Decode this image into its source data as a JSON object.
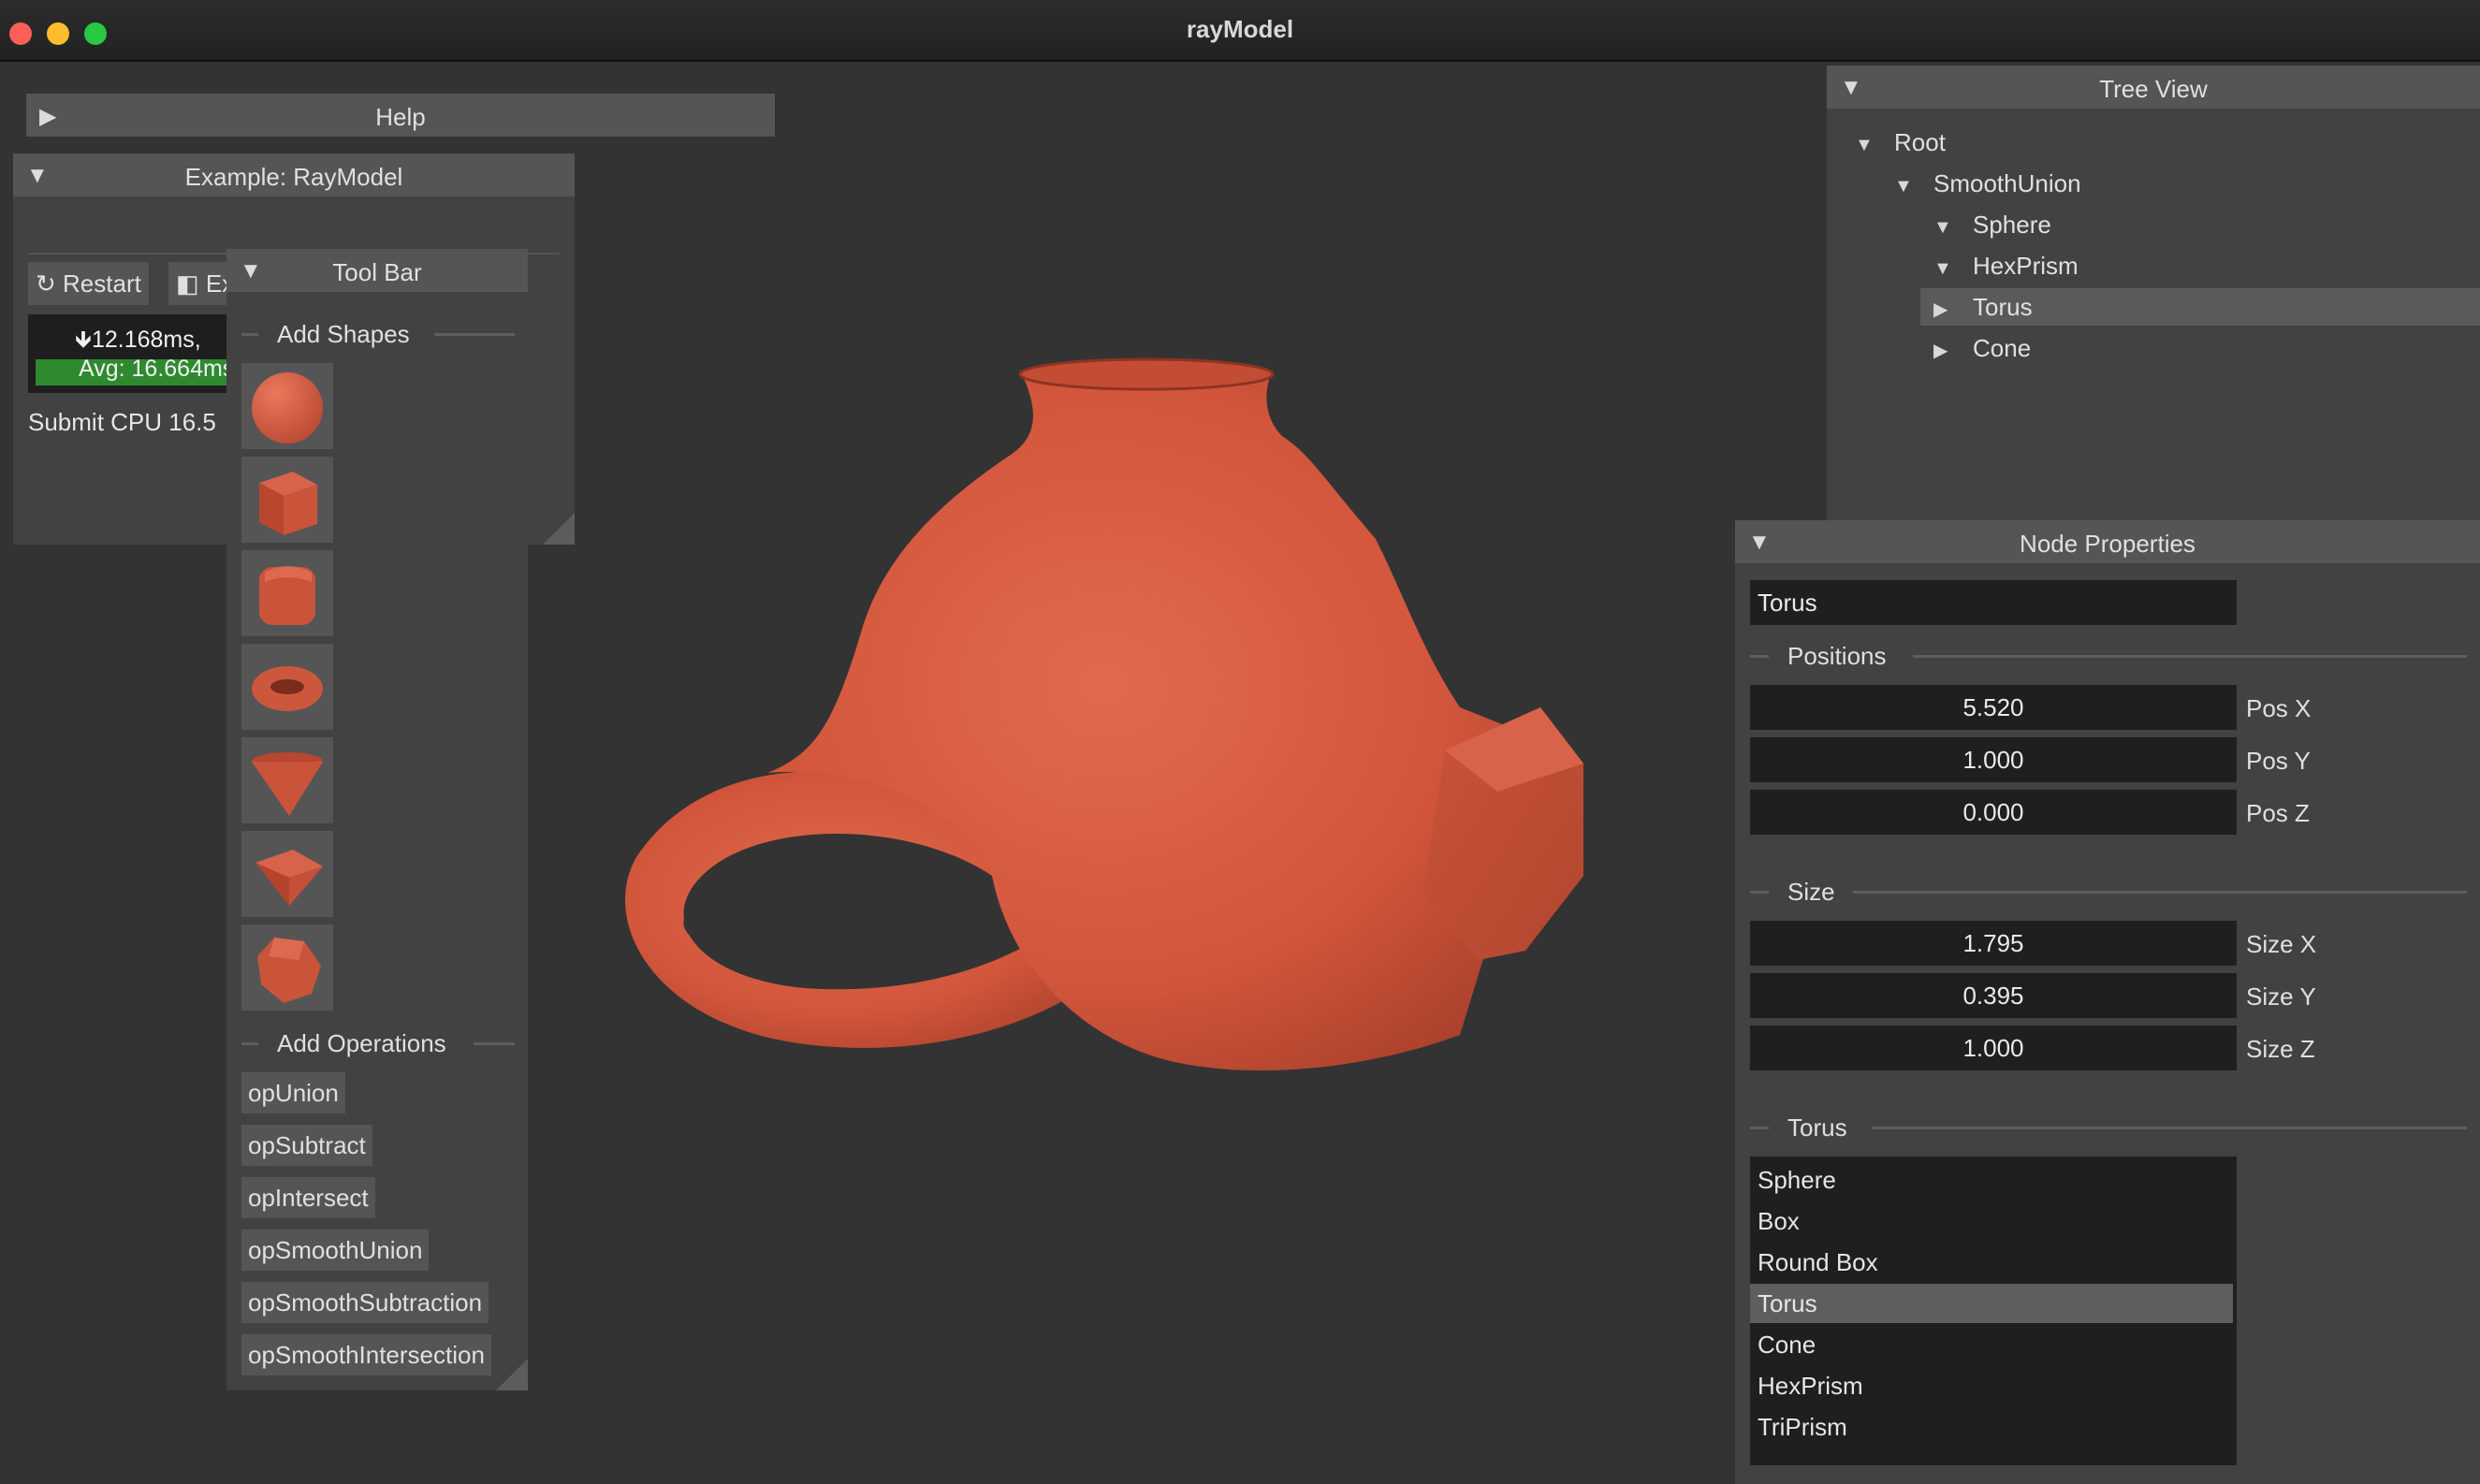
{
  "window": {
    "title": "rayModel"
  },
  "help_panel": {
    "title": "Help"
  },
  "example_panel": {
    "title": "Example: RayModel",
    "restart_label": "Restart",
    "exit_label": "Ex",
    "frame_time": "12.168ms,",
    "avg_time": "Avg: 16.664ms",
    "cpu_text": "Submit CPU 16.5"
  },
  "toolbar": {
    "title": "Tool Bar",
    "add_shapes_label": "Add Shapes",
    "add_operations_label": "Add Operations",
    "shapes": [
      "sphere-icon",
      "box-icon",
      "round-box-icon",
      "torus-icon",
      "cone-icon",
      "triprism-icon",
      "hexprism-icon"
    ],
    "operations": [
      "opUnion",
      "opSubtract",
      "opIntersect",
      "opSmoothUnion",
      "opSmoothSubtraction",
      "opSmoothIntersection"
    ]
  },
  "tree_view": {
    "title": "Tree View",
    "nodes": [
      {
        "label": "Root",
        "expanded": true
      },
      {
        "label": "SmoothUnion",
        "expanded": true
      },
      {
        "label": "Sphere",
        "expanded": true
      },
      {
        "label": "HexPrism",
        "expanded": true
      },
      {
        "label": "Torus",
        "expanded": false,
        "selected": true
      },
      {
        "label": "Cone",
        "expanded": false
      }
    ]
  },
  "node_properties": {
    "title": "Node Properties",
    "name": "Torus",
    "positions_label": "Positions",
    "pos_x": "5.520",
    "pos_x_label": "Pos X",
    "pos_y": "1.000",
    "pos_y_label": "Pos Y",
    "pos_z": "0.000",
    "pos_z_label": "Pos Z",
    "size_label": "Size",
    "size_x": "1.795",
    "size_x_label": "Size X",
    "size_y": "0.395",
    "size_y_label": "Size Y",
    "size_z": "1.000",
    "size_z_label": "Size Z",
    "type_label": "Torus",
    "types": [
      "Sphere",
      "Box",
      "Round Box",
      "Torus",
      "Cone",
      "HexPrism",
      "TriPrism"
    ],
    "selected_type": "Torus"
  },
  "colors": {
    "model": "#d4583f",
    "accent_green": "#2f8a2f"
  }
}
